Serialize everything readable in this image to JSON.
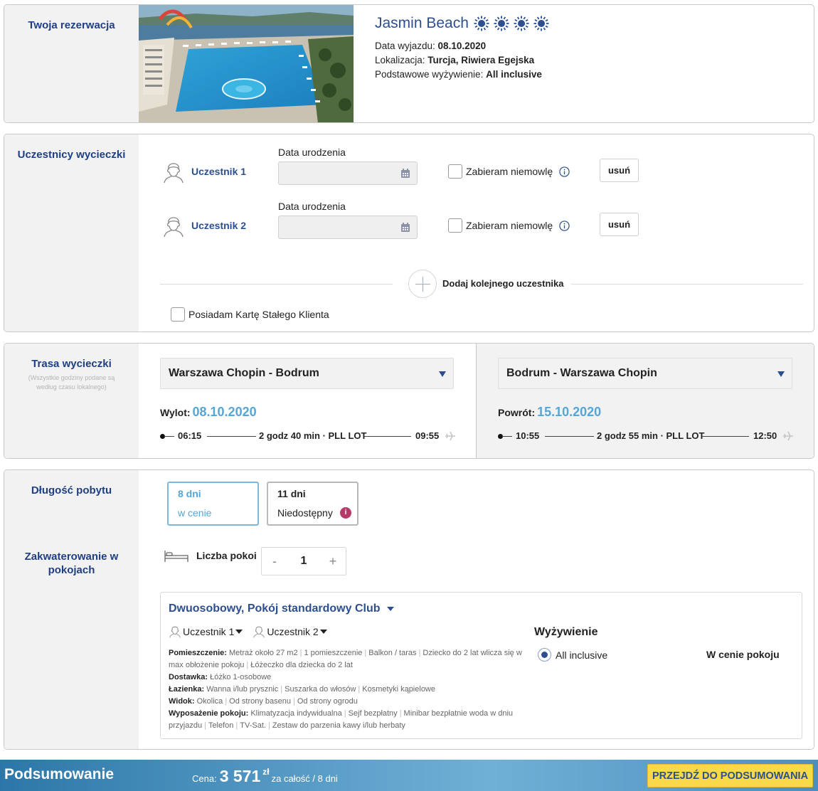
{
  "reservation": {
    "section_title": "Twoja rezerwacja",
    "hotel_name": "Jasmin Beach",
    "star_count": 4,
    "departure_label": "Data wyjazdu: ",
    "departure_value": "08.10.2020",
    "location_label": "Lokalizacja: ",
    "location_value": "Turcja, Riwiera Egejska",
    "board_label": "Podstawowe wyżywienie: ",
    "board_value": "All inclusive"
  },
  "participants": {
    "section_title": "Uczestnicy wycieczki",
    "items": [
      {
        "name": "Uczestnik 1",
        "dob_label": "Data urodzenia",
        "dob_value": "",
        "infant_label": "Zabieram niemowlę",
        "remove_label": "usuń"
      },
      {
        "name": "Uczestnik 2",
        "dob_label": "Data urodzenia",
        "dob_value": "",
        "infant_label": "Zabieram niemowlę",
        "remove_label": "usuń"
      }
    ],
    "add_label": "Dodaj kolejnego uczestnika",
    "loyalty_label": "Posiadam Kartę Stałego Klienta"
  },
  "route": {
    "section_title": "Trasa wycieczki",
    "note": "(Wszystkie godziny podane są według czasu lokalnego)",
    "outbound": {
      "route": "Warszawa Chopin - Bodrum",
      "date_label": "Wylot:",
      "date": "08.10.2020",
      "dep_time": "06:15",
      "duration": "2 godz 40 min · PLL LOT",
      "arr_time": "09:55"
    },
    "return": {
      "route": "Bodrum - Warszawa Chopin",
      "date_label": "Powrót:",
      "date": "15.10.2020",
      "dep_time": "10:55",
      "duration": "2 godz 55 min · PLL LOT",
      "arr_time": "12:50"
    }
  },
  "stay": {
    "section_title": "Długość pobytu",
    "options": [
      {
        "days": "8 dni",
        "status": "w cenie"
      },
      {
        "days": "11 dni",
        "status": "Niedostępny",
        "info_glyph": "i"
      }
    ]
  },
  "rooms": {
    "section_title": "Zakwaterowanie w pokojach",
    "count_label": "Liczba pokoi",
    "minus": "-",
    "count": "1",
    "plus": "+",
    "room_type": "Dwuosobowy, Pokój standardowy Club",
    "occupants": [
      "Uczestnik 1",
      "Uczestnik 2"
    ],
    "specs": [
      {
        "label": "Pomieszczenie:",
        "values": [
          "Metraż około 27 m2",
          "1 pomieszczenie",
          "Balkon / taras",
          "Dziecko do 2 lat wlicza się w max obłożenie pokoju",
          "Łóżeczko dla dziecka do 2 lat"
        ]
      },
      {
        "label": "Dostawka:",
        "values": [
          "Łóżko 1-osobowe"
        ]
      },
      {
        "label": "Łazienka:",
        "values": [
          "Wanna i/lub prysznic",
          "Suszarka do włosów",
          "Kosmetyki kąpielowe"
        ]
      },
      {
        "label": "Widok:",
        "values": [
          "Okolica",
          "Od strony basenu",
          "Od strony ogrodu"
        ]
      },
      {
        "label": "Wyposażenie pokoju:",
        "values": [
          "Klimatyzacja indywidualna",
          "Sejf bezpłatny",
          "Minibar bezpłatnie woda w dniu przyjazdu",
          "Telefon",
          "TV-Sat.",
          "Zestaw do parzenia kawy i/lub herbaty"
        ]
      }
    ],
    "meal_heading": "Wyżywienie",
    "meal_option": "All inclusive",
    "meal_price": "W cenie pokoju"
  },
  "footer": {
    "title": "Podsumowanie",
    "price_label": "Cena:",
    "price": "3 571",
    "currency": "zł",
    "per": "za całość / 8 dni",
    "cta": "PRZEJDŹ DO PODSUMOWANIA"
  },
  "colors": {
    "navy": "#1f3f83",
    "accent_blue": "#55a6d7",
    "cta_yellow": "#f8d94a",
    "info_magenta": "#b53a6a"
  }
}
